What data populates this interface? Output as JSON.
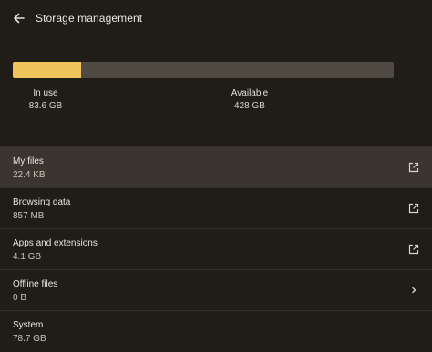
{
  "header": {
    "title": "Storage management",
    "back_icon": "arrow-left-icon"
  },
  "storage": {
    "used_fraction": 0.18,
    "fill_color": "#f0c45c",
    "track_color": "#4f4a42",
    "in_use_label": "In use",
    "in_use_value": "83.6 GB",
    "available_label": "Available",
    "available_value": "428 GB"
  },
  "items": [
    {
      "title": "My files",
      "size": "22.4 KB",
      "icon": "open-in-new-icon",
      "active": true
    },
    {
      "title": "Browsing data",
      "size": "857 MB",
      "icon": "open-in-new-icon",
      "active": false
    },
    {
      "title": "Apps and extensions",
      "size": "4.1 GB",
      "icon": "open-in-new-icon",
      "active": false
    },
    {
      "title": "Offline files",
      "size": "0 B",
      "icon": "chevron-right-icon",
      "active": false
    },
    {
      "title": "System",
      "size": "78.7 GB",
      "icon": "",
      "active": false
    }
  ]
}
